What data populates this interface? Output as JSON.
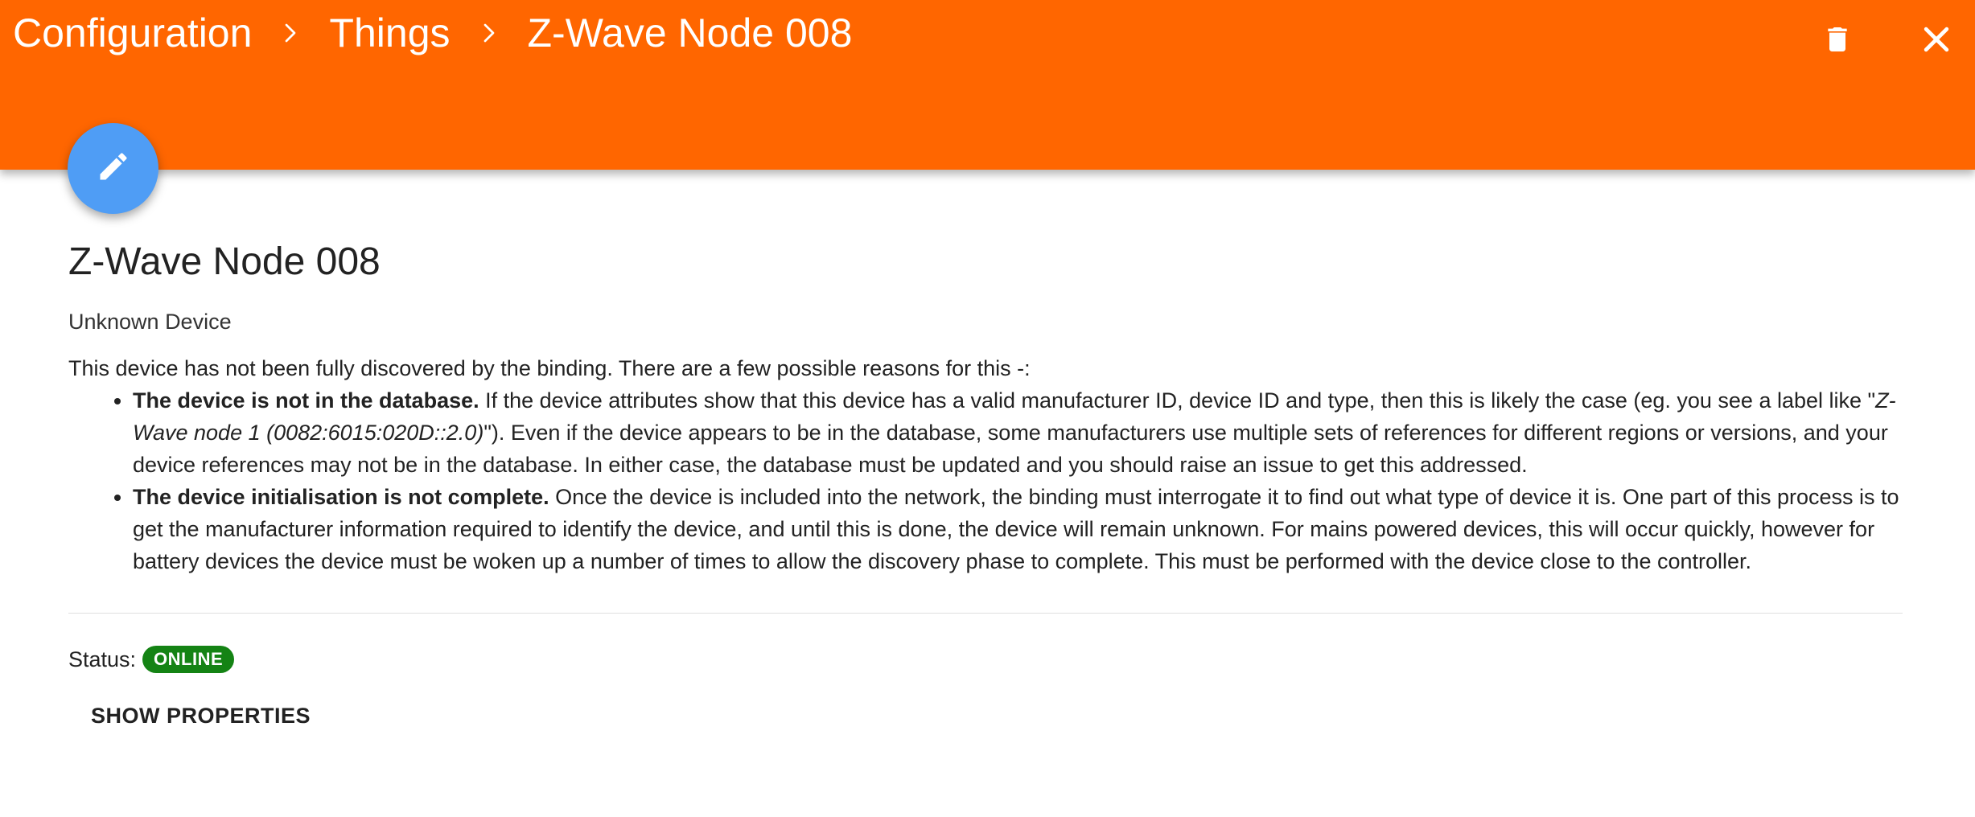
{
  "header": {
    "breadcrumb": [
      "Configuration",
      "Things",
      "Z-Wave Node 008"
    ],
    "background_color": "#ff6600",
    "actions": [
      {
        "icon": "trash-icon"
      },
      {
        "icon": "close-icon"
      }
    ]
  },
  "fab": {
    "icon": "pencil-icon",
    "color": "#4f9df5"
  },
  "thing": {
    "title": "Z-Wave Node 008",
    "subtitle": "Unknown Device",
    "description": "This device has not been fully discovered by the binding. There are a few possible reasons for this -:",
    "reasons": [
      {
        "heading": "The device is not in the database.",
        "text_before_label": " If the device attributes show that this device has a valid manufacturer ID, device ID and type, then this is likely the case (eg. you see a label like \"",
        "example_label": "Z-Wave node 1 (0082:6015:020D::2.0)",
        "text_after_label": "\"). Even if the device appears to be in the database, some manufacturers use multiple sets of references for different regions or versions, and your device references may not be in the database. In either case, the database must be updated and you should raise an issue to get this addressed."
      },
      {
        "heading": "The device initialisation is not complete.",
        "text": " Once the device is included into the network, the binding must interrogate it to find out what type of device it is. One part of this process is to get the manufacturer information required to identify the device, and until this is done, the device will remain unknown. For mains powered devices, this will occur quickly, however for battery devices the device must be woken up a number of times to allow the discovery phase to complete. This must be performed with the device close to the controller."
      }
    ],
    "status_label": "Status:",
    "status": "ONLINE",
    "status_color": "#148314",
    "show_properties_label": "SHOW PROPERTIES"
  }
}
